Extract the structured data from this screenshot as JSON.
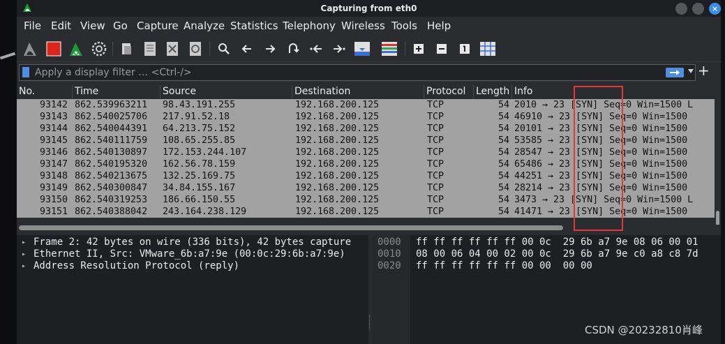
{
  "window": {
    "title": "Capturing from eth0",
    "close_glyph": "×"
  },
  "menu": [
    "File",
    "Edit",
    "View",
    "Go",
    "Capture",
    "Analyze",
    "Statistics",
    "Telephony",
    "Wireless",
    "Tools",
    "Help"
  ],
  "filter": {
    "placeholder": "Apply a display filter … <Ctrl-/>",
    "add_glyph": "+"
  },
  "columns": [
    "No.",
    "Time",
    "Source",
    "Destination",
    "Protocol",
    "Length",
    "Info"
  ],
  "packets": [
    {
      "no": "93142",
      "time": "862.539963211",
      "src": "98.43.191.255",
      "dst": "192.168.200.125",
      "proto": "TCP",
      "len": "54",
      "info": "2010 → 23 [SYN] Seq=0 Win=1500 L"
    },
    {
      "no": "93143",
      "time": "862.540025706",
      "src": "217.91.52.18",
      "dst": "192.168.200.125",
      "proto": "TCP",
      "len": "54",
      "info": "46910 → 23 [SYN] Seq=0 Win=1500"
    },
    {
      "no": "93144",
      "time": "862.540044391",
      "src": "64.213.75.152",
      "dst": "192.168.200.125",
      "proto": "TCP",
      "len": "54",
      "info": "20101 → 23 [SYN] Seq=0 Win=1500"
    },
    {
      "no": "93145",
      "time": "862.540111759",
      "src": "108.65.255.85",
      "dst": "192.168.200.125",
      "proto": "TCP",
      "len": "54",
      "info": "53585 → 23 [SYN] Seq=0 Win=1500"
    },
    {
      "no": "93146",
      "time": "862.540130897",
      "src": "172.153.244.107",
      "dst": "192.168.200.125",
      "proto": "TCP",
      "len": "54",
      "info": "28547 → 23 [SYN] Seq=0 Win=1500"
    },
    {
      "no": "93147",
      "time": "862.540195320",
      "src": "162.56.78.159",
      "dst": "192.168.200.125",
      "proto": "TCP",
      "len": "54",
      "info": "65486 → 23 [SYN] Seq=0 Win=1500"
    },
    {
      "no": "93148",
      "time": "862.540213675",
      "src": "132.25.169.75",
      "dst": "192.168.200.125",
      "proto": "TCP",
      "len": "54",
      "info": "44251 → 23 [SYN] Seq=0 Win=1500"
    },
    {
      "no": "93149",
      "time": "862.540300847",
      "src": "34.84.155.167",
      "dst": "192.168.200.125",
      "proto": "TCP",
      "len": "54",
      "info": "28214 → 23 [SYN] Seq=0 Win=1500"
    },
    {
      "no": "93150",
      "time": "862.540319253",
      "src": "186.66.150.55",
      "dst": "192.168.200.125",
      "proto": "TCP",
      "len": "54",
      "info": "3473 → 23 [SYN] Seq=0 Win=1500 L"
    },
    {
      "no": "93151",
      "time": "862.540388042",
      "src": "243.164.238.129",
      "dst": "192.168.200.125",
      "proto": "TCP",
      "len": "54",
      "info": "41471 → 23 [SYN] Seq=0 Win=1500"
    }
  ],
  "details": [
    "Frame 2: 42 bytes on wire (336 bits), 42 bytes capture",
    "Ethernet II, Src: VMware_6b:a7:9e (00:0c:29:6b:a7:9e)",
    "Address Resolution Protocol (reply)"
  ],
  "detail_arrow": "▸",
  "bytes": [
    {
      "offset": "0000",
      "hex": "ff ff ff ff ff ff 00 0c  29 6b a7 9e 08 06 00 01"
    },
    {
      "offset": "0010",
      "hex": "08 00 06 04 00 02 00 0c  29 6b a7 9e c0 a8 c8 7d"
    },
    {
      "offset": "0020",
      "hex": "ff ff ff ff ff ff 00 00  00 00"
    }
  ],
  "watermark": "CSDN @20232810肖峰",
  "colors": {
    "packet_row_bg": "#a2a2a2",
    "highlight_border": "#e23a3a",
    "accent": "#4e8fe0"
  }
}
